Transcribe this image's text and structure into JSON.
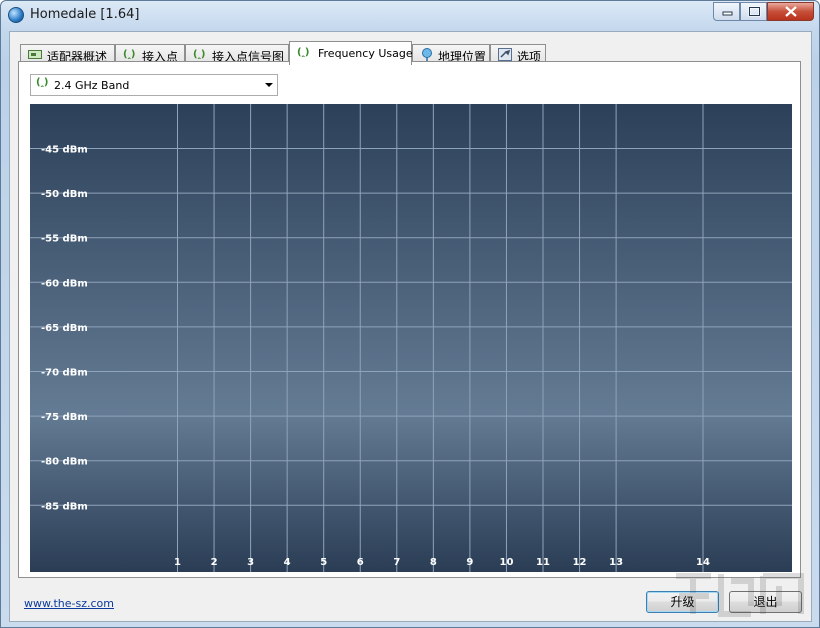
{
  "window": {
    "title": "Homedale [1.64]",
    "min_label": "▭",
    "max_label": "□",
    "close_label": "✕"
  },
  "tabs": [
    {
      "label": "适配器概述",
      "icon": "network-card-icon",
      "active": false
    },
    {
      "label": "接入点",
      "icon": "antenna-icon",
      "active": false
    },
    {
      "label": "接入点信号图",
      "icon": "antenna-icon",
      "active": false
    },
    {
      "label": "Frequency Usage",
      "icon": "antenna-icon",
      "active": true
    },
    {
      "label": "地理位置",
      "icon": "location-pin-icon",
      "active": false
    },
    {
      "label": "选项",
      "icon": "settings-icon",
      "active": false
    }
  ],
  "band_select": {
    "value": "2.4 GHz Band",
    "icon": "antenna-icon"
  },
  "chart_data": {
    "type": "line",
    "title": "",
    "xlabel": "",
    "ylabel": "",
    "y_ticks": [
      "-45 dBm",
      "-50 dBm",
      "-55 dBm",
      "-60 dBm",
      "-65 dBm",
      "-70 dBm",
      "-75 dBm",
      "-80 dBm",
      "-85 dBm"
    ],
    "y_values": [
      -45,
      -50,
      -55,
      -60,
      -65,
      -70,
      -75,
      -80,
      -85
    ],
    "ylim": [
      -90,
      -40
    ],
    "x_ticks": [
      "1",
      "2",
      "3",
      "4",
      "5",
      "6",
      "7",
      "8",
      "9",
      "10",
      "11",
      "12",
      "13",
      "14"
    ],
    "x_values": [
      1,
      2,
      3,
      4,
      5,
      6,
      7,
      8,
      9,
      10,
      11,
      12,
      13,
      14
    ],
    "series": [],
    "grid": true,
    "colors": {
      "bg_top": "#2c4059",
      "bg_mid": "#647b94",
      "bg_bottom": "#2a3d55",
      "grid": "#8fa3ba",
      "label": "#ffffff"
    }
  },
  "footer": {
    "link": "www.the-sz.com",
    "upgrade_label": "升级",
    "exit_label": "退出"
  }
}
